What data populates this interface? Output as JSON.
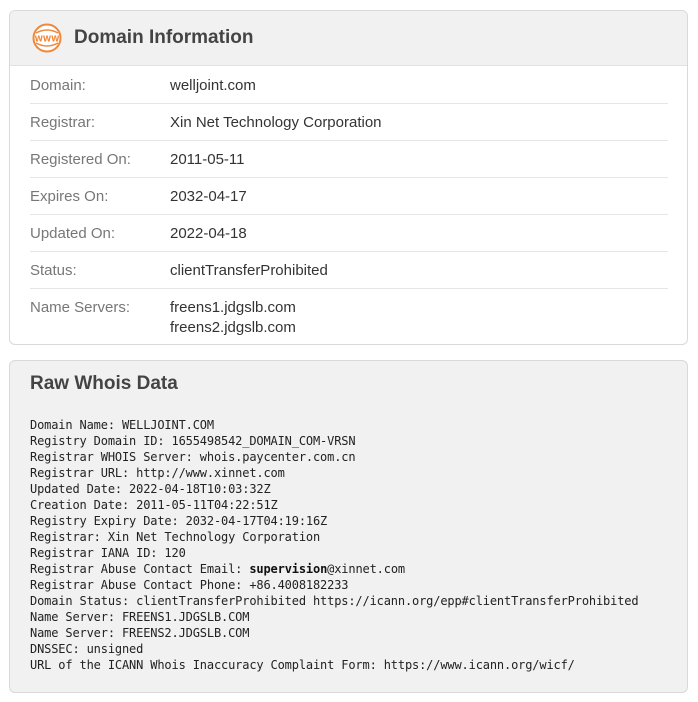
{
  "domain_info": {
    "title": "Domain Information",
    "icon_text": "WWW",
    "rows": [
      {
        "label": "Domain:",
        "value": "welljoint.com"
      },
      {
        "label": "Registrar:",
        "value": "Xin Net Technology Corporation"
      },
      {
        "label": "Registered On:",
        "value": "2011-05-11"
      },
      {
        "label": "Expires On:",
        "value": "2032-04-17"
      },
      {
        "label": "Updated On:",
        "value": "2022-04-18"
      },
      {
        "label": "Status:",
        "value": "clientTransferProhibited"
      }
    ],
    "name_servers": {
      "label": "Name Servers:",
      "values": [
        "freens1.jdgslb.com",
        "freens2.jdgslb.com"
      ]
    }
  },
  "raw_whois": {
    "title": "Raw Whois Data",
    "lines": [
      "Domain Name: WELLJOINT.COM",
      "Registry Domain ID: 1655498542_DOMAIN_COM-VRSN",
      "Registrar WHOIS Server: whois.paycenter.com.cn",
      "Registrar URL: http://www.xinnet.com",
      "Updated Date: 2022-04-18T10:03:32Z",
      "Creation Date: 2011-05-11T04:22:51Z",
      "Registry Expiry Date: 2032-04-17T04:19:16Z",
      "Registrar: Xin Net Technology Corporation",
      "Registrar IANA ID: 120"
    ],
    "email_line": {
      "prefix": "Registrar Abuse Contact Email: ",
      "user": "supervision",
      "domain": "@xinnet.com"
    },
    "lines_after": [
      "Registrar Abuse Contact Phone: +86.4008182233",
      "Domain Status: clientTransferProhibited https://icann.org/epp#clientTransferProhibited",
      "Name Server: FREENS1.JDGSLB.COM",
      "Name Server: FREENS2.JDGSLB.COM",
      "DNSSEC: unsigned",
      "URL of the ICANN Whois Inaccuracy Complaint Form: https://www.icann.org/wicf/"
    ]
  },
  "colors": {
    "accent": "#f0883a",
    "header_bg": "#f1f1f1",
    "border": "#d9d9d9"
  }
}
